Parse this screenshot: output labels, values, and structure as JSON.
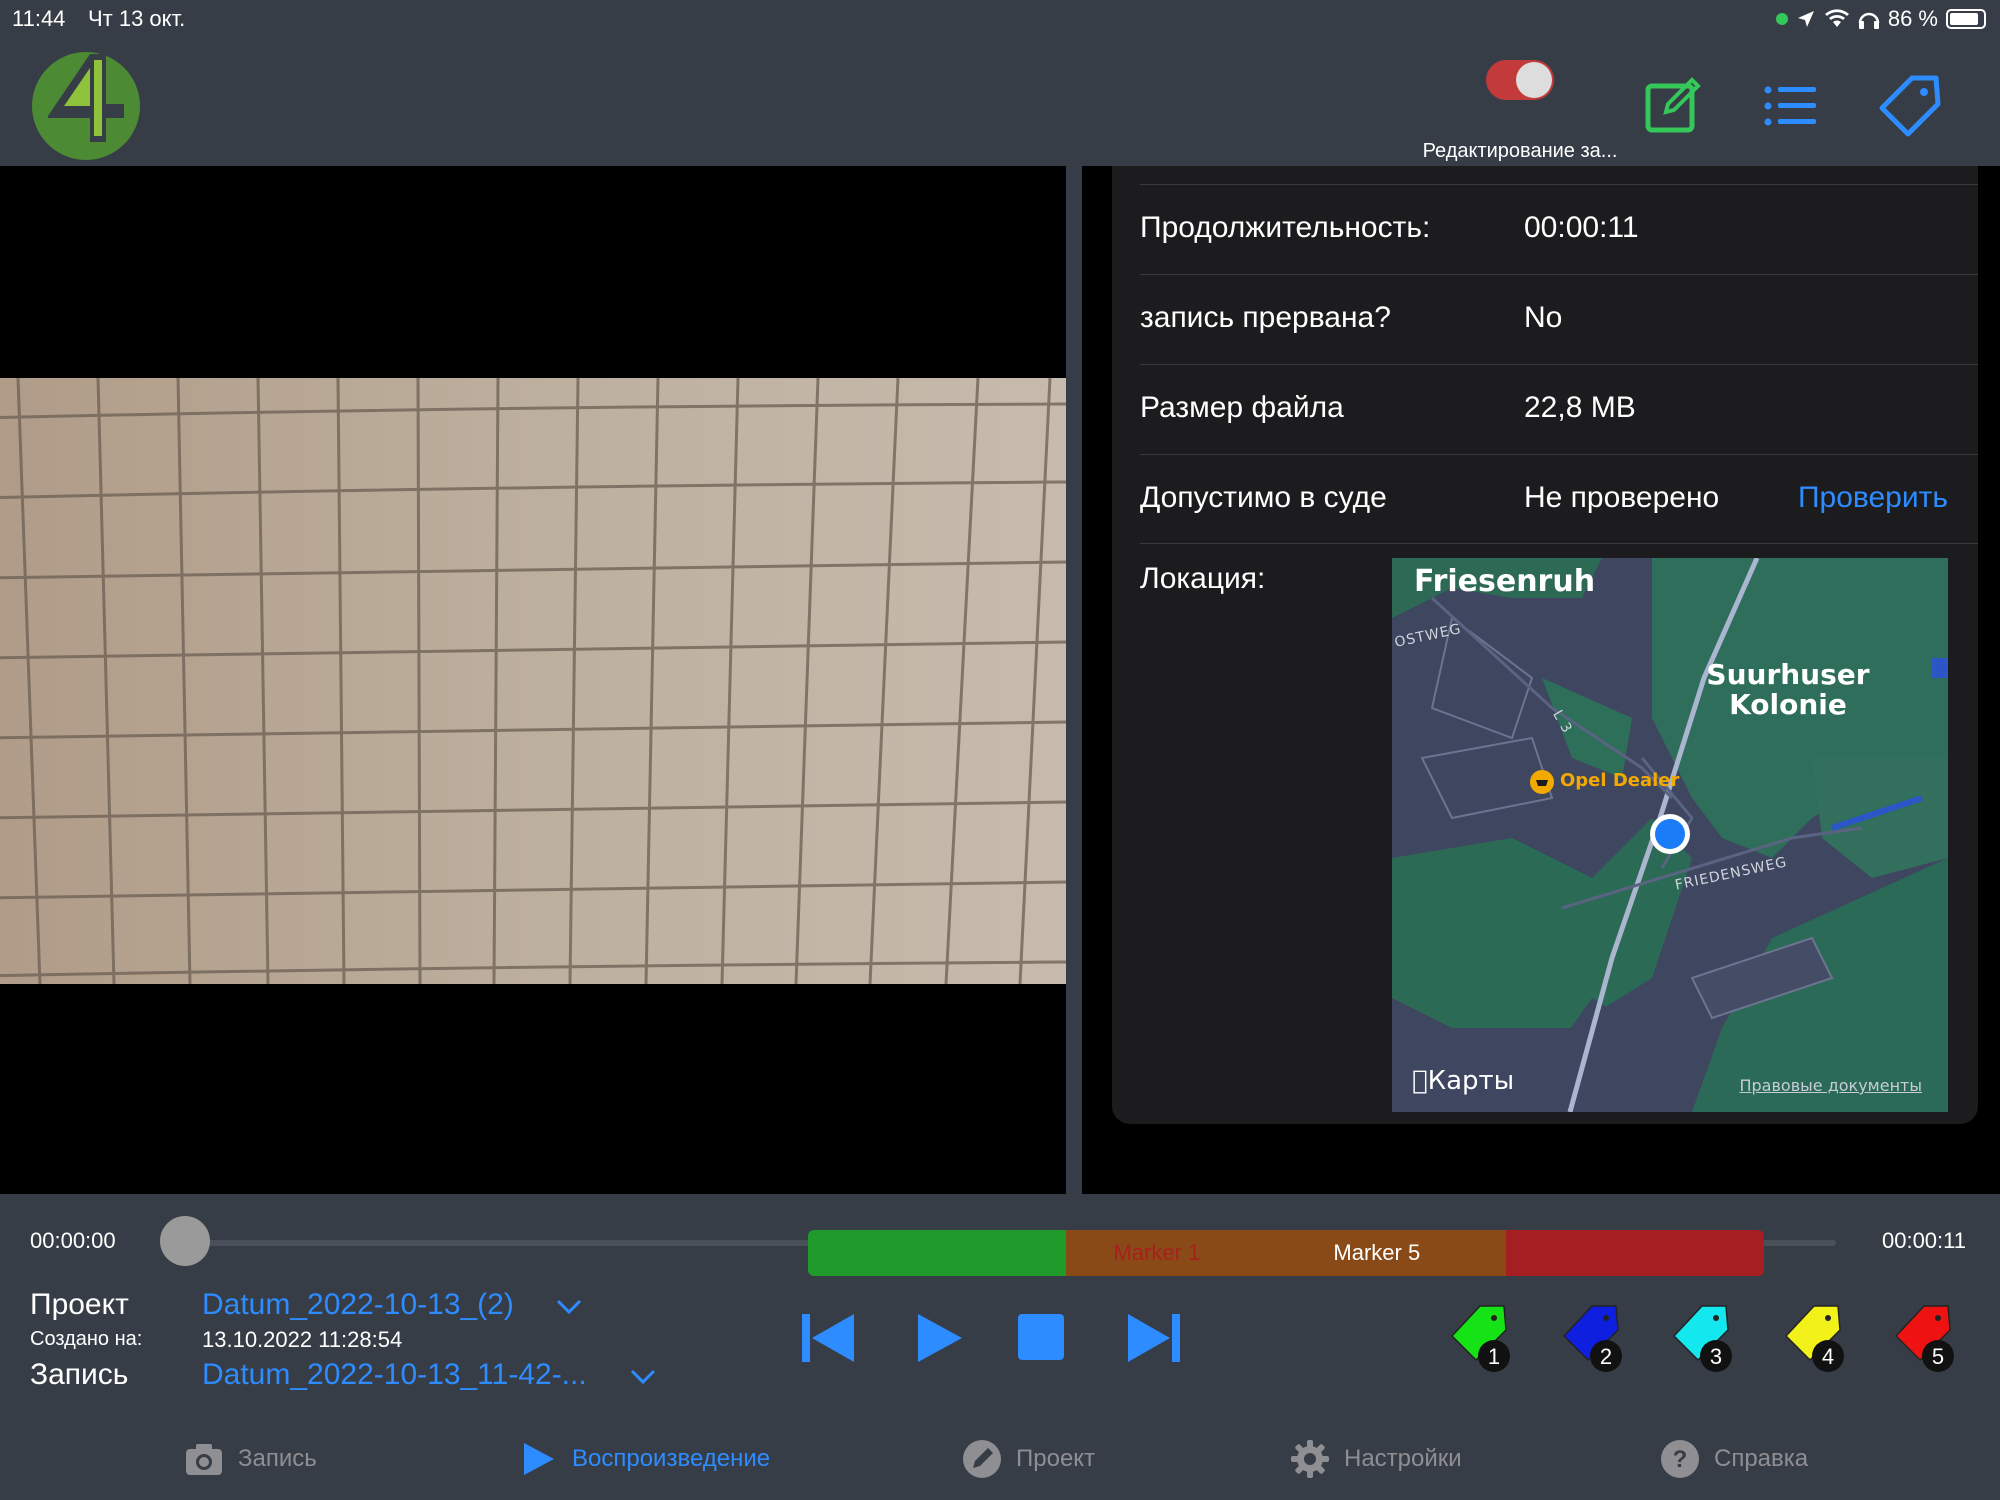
{
  "status_bar": {
    "time": "11:44",
    "date": "Чт 13 окт.",
    "battery": "86 %"
  },
  "header": {
    "toggle_label": "Редактирование за...",
    "toggle_on": false,
    "icons": [
      "edit-icon",
      "list-icon",
      "tag-icon"
    ]
  },
  "details": {
    "rows": [
      {
        "key": "Продолжительность:",
        "value": "00:00:11"
      },
      {
        "key": "запись прервана?",
        "value": "No"
      },
      {
        "key": "Размер файла",
        "value": "22,8 MB"
      },
      {
        "key": "Допустимо в суде",
        "value": "Не проверено",
        "action": "Проверить"
      }
    ],
    "location_label": "Локация:"
  },
  "map": {
    "places": [
      "Friesenruh",
      "Suurhuser Kolonie"
    ],
    "streets": [
      "OSTWEG",
      "L 3",
      "FRIEDENSWEG"
    ],
    "poi": "Opel Dealer",
    "brand": "Карты",
    "legal": "Правовые документы"
  },
  "player": {
    "time_start": "00:00:00",
    "time_end": "00:00:11",
    "progress": 0.0,
    "markers": [
      {
        "label": "",
        "color": "#1f9a2b",
        "start": 0.0,
        "end": 0.27
      },
      {
        "label": "Marker 1",
        "color": "#8a4a17",
        "start": 0.27,
        "end": 0.46
      },
      {
        "label": "Marker 5",
        "color": "#8a4a17",
        "start": 0.46,
        "end": 0.73
      },
      {
        "label": "",
        "color": "#a51e22",
        "start": 0.73,
        "end": 1.0
      }
    ]
  },
  "project": {
    "project_label": "Проект",
    "project_value": "Datum_2022-10-13_(2)",
    "created_label": "Создано на:",
    "created_value": "13.10.2022 11:28:54",
    "record_label": "Запись",
    "record_value": "Datum_2022-10-13_11-42-..."
  },
  "tags": [
    {
      "number": "1",
      "color": "#16e316"
    },
    {
      "number": "2",
      "color": "#0f1fe0"
    },
    {
      "number": "3",
      "color": "#12e8ee"
    },
    {
      "number": "4",
      "color": "#f2f21a"
    },
    {
      "number": "5",
      "color": "#ee1212"
    }
  ],
  "tabbar": [
    {
      "label": "Запись",
      "icon": "camera-icon",
      "active": false
    },
    {
      "label": "Воспроизведение",
      "icon": "play-icon",
      "active": true
    },
    {
      "label": "Проект",
      "icon": "pencil-icon",
      "active": false
    },
    {
      "label": "Настройки",
      "icon": "gear-icon",
      "active": false
    },
    {
      "label": "Справка",
      "icon": "help-icon",
      "active": false
    }
  ],
  "colors": {
    "accent": "#2d8cff",
    "background": "#373d46",
    "panel": "#1c1c1e"
  }
}
